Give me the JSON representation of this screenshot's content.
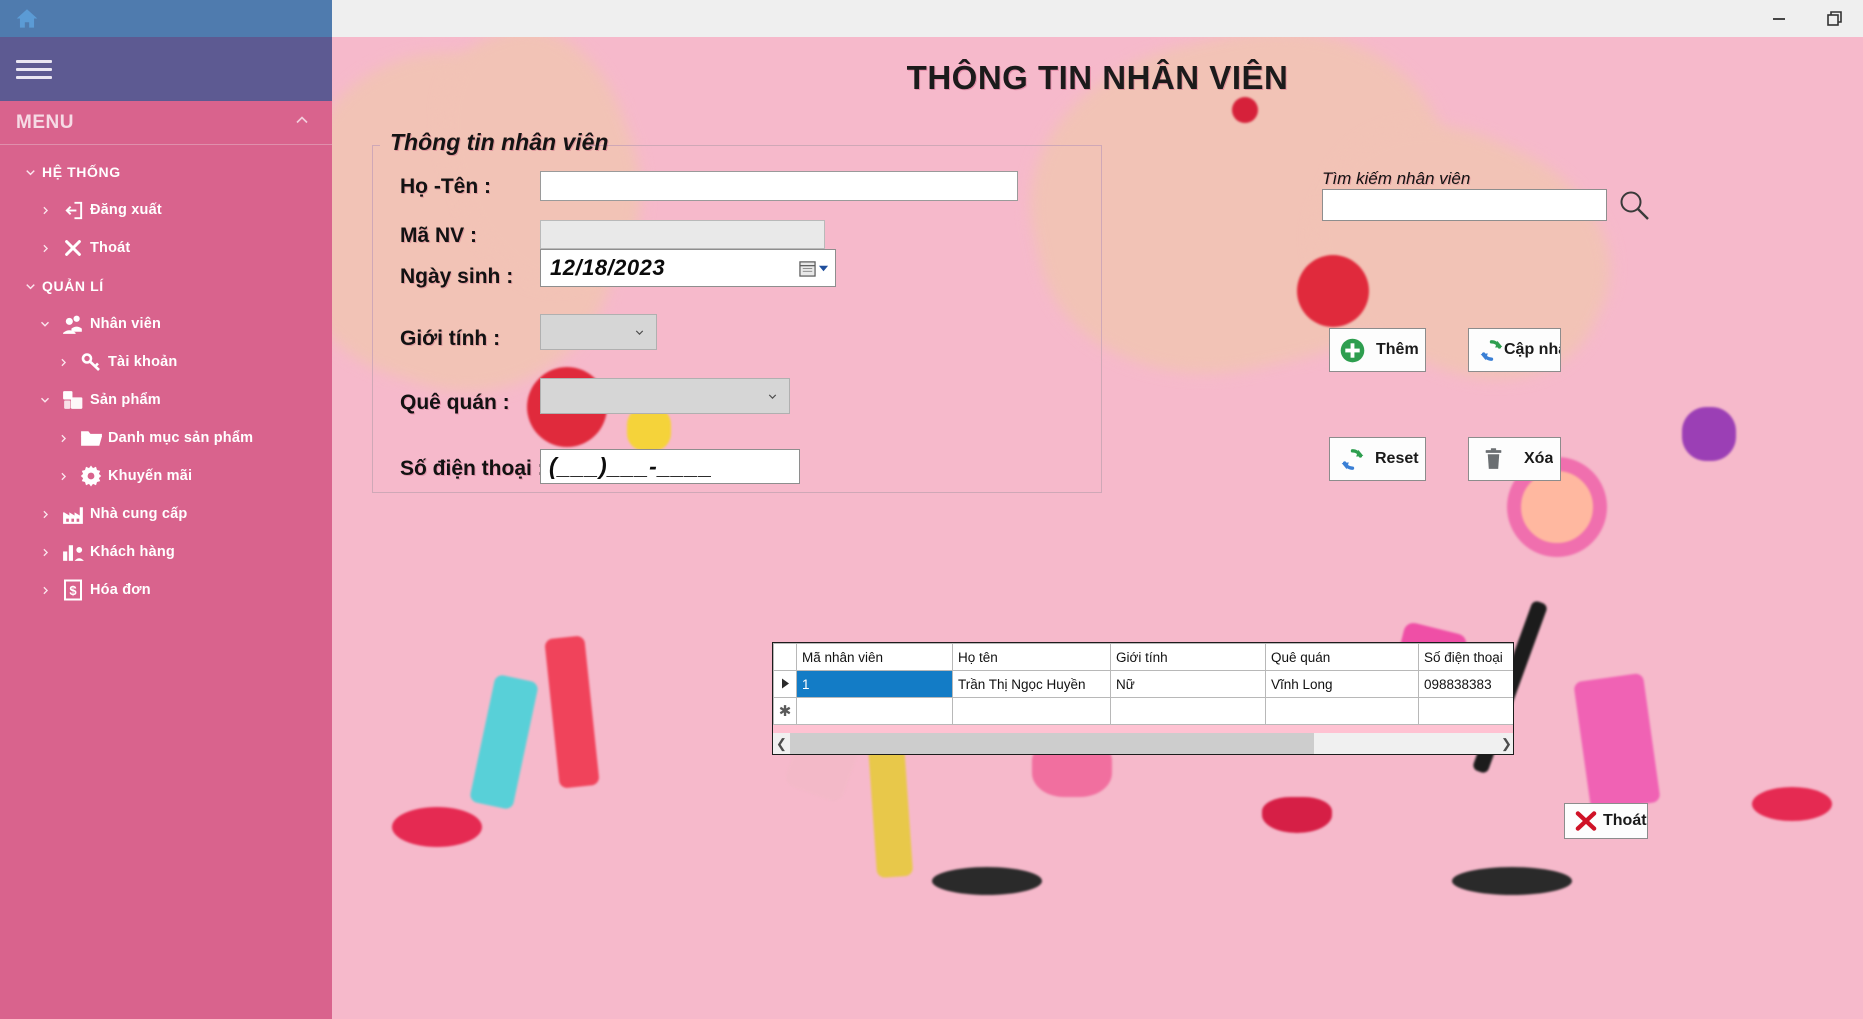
{
  "window": {
    "controls": [
      {
        "name": "minimize",
        "glyph": "minimize-icon"
      },
      {
        "name": "restore",
        "glyph": "restore-icon"
      }
    ]
  },
  "sidebar": {
    "home_icon": "home-icon",
    "hamburger_icon": "hamburger-icon",
    "menu_title": "MENU",
    "collapse_icon": "chevron-up-icon",
    "items": [
      {
        "label": "HỆ THỐNG",
        "level": 0,
        "caret": "chevron-down-icon",
        "icon": ""
      },
      {
        "label": "Đăng xuất",
        "level": 1,
        "caret": "chevron-right-icon",
        "icon": "logout-icon"
      },
      {
        "label": "Thoát",
        "level": 1,
        "caret": "chevron-right-icon",
        "icon": "close-x-icon"
      },
      {
        "label": "QUẢN LÍ",
        "level": 0,
        "caret": "chevron-down-icon",
        "icon": ""
      },
      {
        "label": "Nhân viên",
        "level": 1,
        "caret": "chevron-down-icon",
        "icon": "users-icon"
      },
      {
        "label": "Tài khoản",
        "level": 2,
        "caret": "chevron-right-icon",
        "icon": "key-icon"
      },
      {
        "label": "Sản phẩm",
        "level": 1,
        "caret": "chevron-down-icon",
        "icon": "boxes-icon"
      },
      {
        "label": "Danh mục sản phẩm",
        "level": 2,
        "caret": "chevron-right-icon",
        "icon": "folder-icon"
      },
      {
        "label": "Khuyến mãi",
        "level": 2,
        "caret": "chevron-right-icon",
        "icon": "gear-icon"
      },
      {
        "label": "Nhà cung cấp",
        "level": 1,
        "caret": "chevron-right-icon",
        "icon": "factory-icon"
      },
      {
        "label": "Khách hàng",
        "level": 1,
        "caret": "chevron-right-icon",
        "icon": "chart-person-icon"
      },
      {
        "label": "Hóa đơn",
        "level": 1,
        "caret": "chevron-right-icon",
        "icon": "dollar-doc-icon"
      }
    ]
  },
  "main": {
    "page_title": "THÔNG TIN NHÂN VIÊN",
    "groupbox_legend": "Thông tin nhân viên",
    "fields": {
      "name_label": "Họ -Tên :",
      "name_value": "",
      "code_label": "Mã NV :",
      "code_value": "",
      "dob_label": "Ngày sinh :",
      "dob_value": "12/18/2023",
      "dob_picker_icon": "calendar-icon",
      "gender_label": "Giới tính :",
      "gender_value": "",
      "hometown_label": "Quê quán :",
      "hometown_value": "",
      "phone_label": "Số điện thoại :",
      "phone_value": "(___)___-____"
    },
    "search": {
      "label": "Tìm kiếm nhân viên",
      "value": "",
      "placeholder": "",
      "icon": "search-icon"
    },
    "buttons": [
      {
        "label": "Thêm",
        "icon": "plus-circle-icon"
      },
      {
        "label": "Cập nhật",
        "icon": "refresh-icon"
      },
      {
        "label": "Reset",
        "icon": "refresh-icon"
      },
      {
        "label": "Xóa",
        "icon": "trash-icon"
      },
      {
        "label": "Thoát",
        "icon": "red-x-icon"
      }
    ],
    "grid": {
      "columns": [
        "Mã nhân viên",
        "Họ tên",
        "Giới tính",
        "Quê quán",
        "Số điện thoại"
      ],
      "rows": [
        {
          "selector": "current-row-arrow",
          "cells": [
            "1",
            "Trần Thị Ngọc Huyền",
            "Nữ",
            "Vĩnh Long",
            "098838383"
          ],
          "selected_cell_index": 0
        },
        {
          "selector": "new-row-asterisk",
          "cells": [
            "",
            "",
            "",
            "",
            ""
          ],
          "selected_cell_index": -1
        }
      ],
      "scroll_left_icon": "chevron-left-icon",
      "scroll_right_icon": "chevron-right-icon"
    }
  },
  "colors": {
    "sidebar": "#d9638d",
    "sidebar_top": "#4f7bae",
    "sidebar_hamburger": "#5d5a92",
    "page_bg": "#f6b9cb",
    "grid_selected": "#137cc6",
    "grid_filler": "#ffc2d2"
  }
}
